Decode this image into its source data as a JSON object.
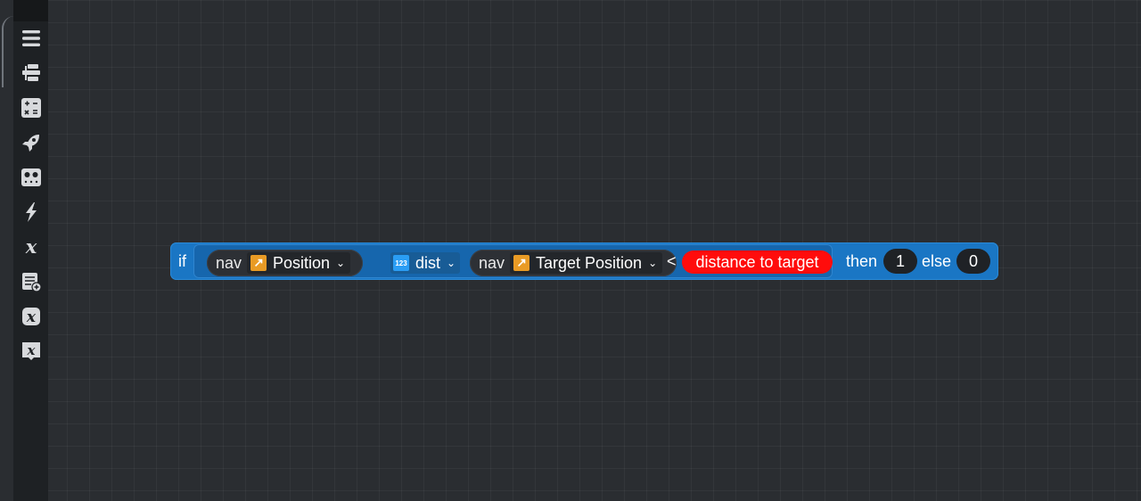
{
  "toolbox": {
    "items": [
      {
        "name": "menu-icon"
      },
      {
        "name": "blocks-icon"
      },
      {
        "name": "math-icon"
      },
      {
        "name": "rocket-icon"
      },
      {
        "name": "robot-icon"
      },
      {
        "name": "lightning-icon"
      },
      {
        "name": "variable-icon"
      },
      {
        "name": "list-add-icon"
      },
      {
        "name": "variable-badge-icon"
      },
      {
        "name": "variable-tag-icon"
      }
    ]
  },
  "block": {
    "if_label": "if",
    "left": {
      "owner": "nav",
      "field": "Position"
    },
    "op": {
      "label": "dist"
    },
    "right": {
      "owner": "nav",
      "field": "Target Position"
    },
    "compare": "<",
    "variable": "distance to target",
    "then_label": "then",
    "then_value": "1",
    "else_label": "else",
    "else_value": "0"
  },
  "colors": {
    "block_blue": "#1a76c4",
    "variable_red": "#ff0c0c",
    "property_orange": "#e99b25",
    "workspace_bg": "#2a2d31"
  }
}
